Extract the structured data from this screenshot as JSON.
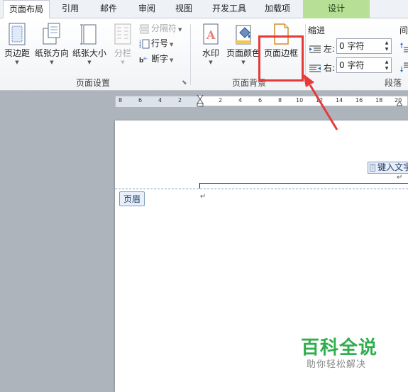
{
  "tabs": [
    {
      "label": "页面布局",
      "active": true
    },
    {
      "label": "引用"
    },
    {
      "label": "邮件"
    },
    {
      "label": "审阅"
    },
    {
      "label": "视图"
    },
    {
      "label": "开发工具"
    },
    {
      "label": "加载项"
    },
    {
      "label": "设计",
      "context": true
    }
  ],
  "page_setup": {
    "group_label": "页面设置",
    "margins_label": "页边距",
    "orientation_label": "纸张方向",
    "size_label": "纸张大小",
    "columns_label": "分栏",
    "breaks_label": "分隔符",
    "line_numbers_label": "行号",
    "hyphenation_label": "断字"
  },
  "page_background": {
    "group_label": "页面背景",
    "watermark_label": "水印",
    "page_color_label": "页面颜色",
    "page_borders_label": "页面边框"
  },
  "paragraph": {
    "group_label": "段落",
    "indent_title": "缩进",
    "left_label": "左:",
    "left_value": "0 字符",
    "right_label": "右:",
    "right_value": "0 字符",
    "spacing_title": "间"
  },
  "ruler_ticks": [
    "8",
    "6",
    "4",
    "2",
    "2",
    "4",
    "6",
    "8",
    "10",
    "12",
    "14",
    "16",
    "18",
    "20"
  ],
  "document": {
    "header_tag": "页眉",
    "type_text_tag": "键入文字",
    "paragraph_mark": "↵"
  },
  "watermark": {
    "title": "百科全说",
    "subtitle": "助你轻松解决"
  },
  "colors": {
    "highlight": "#e53a3a",
    "arrow": "#e53a3a",
    "context_tab": "#b7df96",
    "watermark_green": "#2fae4d"
  }
}
